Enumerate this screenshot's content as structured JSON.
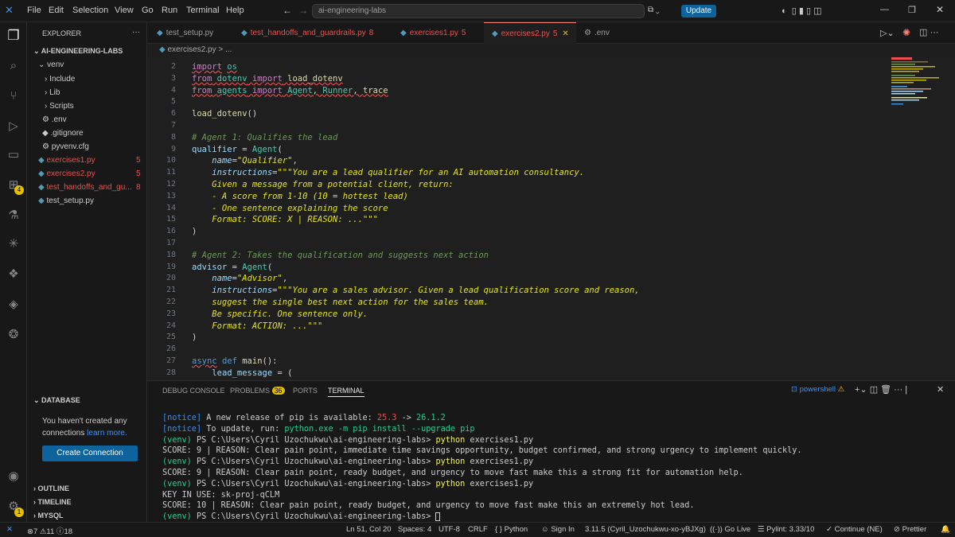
{
  "titlebar": {
    "menu": [
      "File",
      "Edit",
      "Selection",
      "View",
      "Go",
      "Run",
      "Terminal",
      "Help"
    ],
    "search": "ai-engineering-labs",
    "update_label": "Update"
  },
  "sidebar": {
    "explorer_title": "EXPLORER",
    "root": "AI-ENGINEERING-LABS",
    "items": [
      {
        "label": "venv",
        "badge": ""
      },
      {
        "label": "Include",
        "badge": ""
      },
      {
        "label": "Lib",
        "badge": ""
      },
      {
        "label": "Scripts",
        "badge": ""
      },
      {
        "label": ".env",
        "badge": ""
      },
      {
        "label": ".gitignore",
        "badge": ""
      },
      {
        "label": "pyvenv.cfg",
        "badge": ""
      },
      {
        "label": "exercises1.py",
        "badge": "5"
      },
      {
        "label": "exercises2.py",
        "badge": "5"
      },
      {
        "label": "test_handoffs_and_gu...",
        "badge": "8"
      },
      {
        "label": "test_setup.py",
        "badge": ""
      }
    ],
    "database_title": "DATABASE",
    "db_msg1": "You haven't created any",
    "db_msg2": "connections",
    "db_link": "learn more.",
    "create_connection": "Create Connection",
    "outline": "OUTLINE",
    "timeline": "TIMELINE",
    "mysql": "MYSQL"
  },
  "tabs": [
    {
      "label": "test_setup.py",
      "badge": ""
    },
    {
      "label": "test_handoffs_and_guardrails.py",
      "badge": "8"
    },
    {
      "label": "exercises1.py",
      "badge": "5"
    },
    {
      "label": "exercises2.py",
      "badge": "5"
    },
    {
      "label": ".env",
      "badge": ""
    }
  ],
  "breadcrumb": "exercises2.py > ...",
  "editor": {
    "line_numbers": [
      "2",
      "3",
      "4",
      "5",
      "6",
      "7",
      "8",
      "9",
      "10",
      "11",
      "12",
      "13",
      "14",
      "15",
      "16",
      "17",
      "18",
      "19",
      "20",
      "21",
      "22",
      "23",
      "24",
      "25",
      "26",
      "27",
      "28"
    ]
  },
  "panel": {
    "tabs": [
      "DEBUG CONSOLE",
      "PROBLEMS",
      "PORTS",
      "TERMINAL"
    ],
    "problems_count": "36",
    "shell": "powershell"
  },
  "terminal": {
    "line1a": "[notice]",
    "line1b": " A new release of pip is available: ",
    "line1c": "25.3",
    "line1d": " -> ",
    "line1e": "26.1.2",
    "line2a": "[notice]",
    "line2b": " To update, run: ",
    "line2c": "python.exe -m pip install --upgrade pip",
    "prompt_venv": "(venv)",
    "prompt_path": " PS C:\\Users\\Cyril Uzochukwu\\ai-engineering-labs> ",
    "cmd_py": "python",
    "cmd_file": " exercises1.py",
    "out1": "SCORE: 9 | REASON: Clear pain point, immediate time savings opportunity, budget confirmed, and strong urgency to implement quickly.",
    "out2": "SCORE: 9 | REASON: Clear pain point, ready budget, and urgency to move fast make this a strong fit for automation help.",
    "out3": "KEY IN USE: sk-proj-qCLM",
    "out4": "SCORE: 10 | REASON: Clear pain point, ready budget, and urgency to move fast make this an extremely hot lead."
  },
  "status": {
    "errors": "7",
    "warnings": "11",
    "info": "18",
    "position": "Ln 51, Col 20",
    "spaces": "Spaces: 4",
    "encoding": "UTF-8",
    "eol": "CRLF",
    "language": "Python",
    "signin": "Sign In",
    "interpreter": "3.11.5 (Cyril_Uzochukwu-xo-yBJXg)",
    "golive": "Go Live",
    "pylint": "Pylint: 3.33/10",
    "continue": "Continue (NE)",
    "prettier": "Prettier"
  },
  "colors": {
    "accent": "#0e639c",
    "error": "#f14c4c",
    "bg": "#1f1f1f"
  }
}
